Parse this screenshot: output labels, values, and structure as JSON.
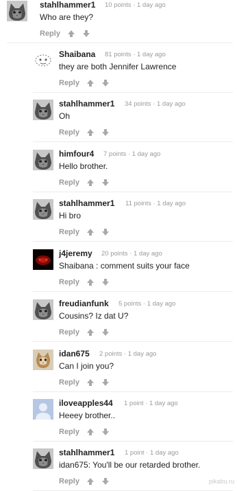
{
  "comments": [
    {
      "username": "stahlhammer1",
      "meta": "10 points · 1 day ago",
      "body": "Who are they?",
      "reply": "Reply",
      "avatar": "cat-avatar-icon",
      "indent": 0
    },
    {
      "username": "Shaibana",
      "meta": "81 points · 1 day ago",
      "body": "they are both Jennifer Lawrence",
      "reply": "Reply",
      "avatar": "sketch-avatar-icon",
      "indent": 1
    },
    {
      "username": "stahlhammer1",
      "meta": "34 points · 1 day ago",
      "body": "Oh",
      "reply": "Reply",
      "avatar": "cat-avatar-icon",
      "indent": 1
    },
    {
      "username": "himfour4",
      "meta": "7 points · 1 day ago",
      "body": "Hello brother.",
      "reply": "Reply",
      "avatar": "cat-avatar-icon",
      "indent": 1
    },
    {
      "username": "stahlhammer1",
      "meta": "11 points · 1 day ago",
      "body": "Hi bro",
      "reply": "Reply",
      "avatar": "cat-avatar-icon",
      "indent": 1
    },
    {
      "username": "j4jeremy",
      "meta": "20 points · 1 day ago",
      "body": "Shaibana : comment suits your face",
      "reply": "Reply",
      "avatar": "red-dark-avatar-icon",
      "indent": 1
    },
    {
      "username": "freudianfunk",
      "meta": "5 points · 1 day ago",
      "body": "Cousins? Iz dat U?",
      "reply": "Reply",
      "avatar": "cat-avatar-icon",
      "indent": 1
    },
    {
      "username": "idan675",
      "meta": "2 points · 1 day ago",
      "body": "Can I join you?",
      "reply": "Reply",
      "avatar": "kitten-avatar-icon",
      "indent": 1
    },
    {
      "username": "iloveapples44",
      "meta": "1 point · 1 day ago",
      "body": "Heeey brother..",
      "reply": "Reply",
      "avatar": "default-user-avatar-icon",
      "indent": 1
    },
    {
      "username": "stahlhammer1",
      "meta": "1 point · 1 day ago",
      "body": "idan675: You'll be our retarded brother.",
      "reply": "Reply",
      "avatar": "cat-avatar-icon",
      "indent": 1
    }
  ],
  "watermark": "pikabu.ru"
}
